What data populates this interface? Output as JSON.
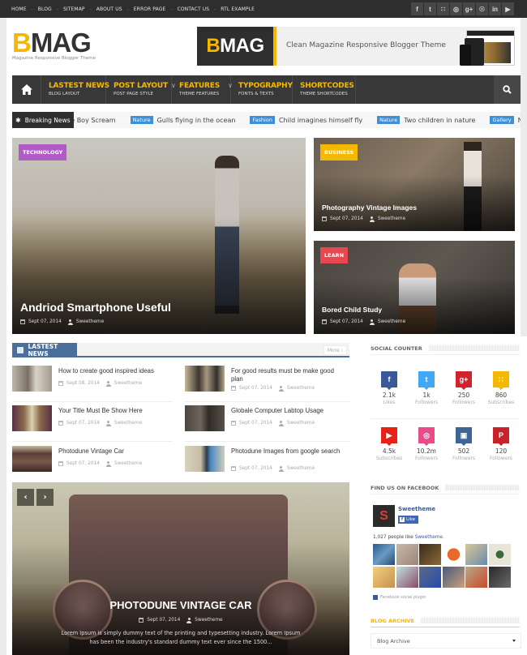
{
  "topbar": {
    "menu": [
      "HOME",
      "BLOG",
      "SITEMAP",
      "ABOUT US",
      "ERROR PAGE",
      "CONTACT US",
      "RTL EXAMPLE"
    ],
    "social": [
      {
        "icon": "facebook-icon",
        "glyph": "f"
      },
      {
        "icon": "twitter-icon",
        "glyph": "t"
      },
      {
        "icon": "rss-icon",
        "glyph": "∷"
      },
      {
        "icon": "dribbble-icon",
        "glyph": "◎"
      },
      {
        "icon": "google-plus-icon",
        "glyph": "g+"
      },
      {
        "icon": "pinterest-icon",
        "glyph": "☉"
      },
      {
        "icon": "linkedin-icon",
        "glyph": "in"
      },
      {
        "icon": "youtube-icon",
        "glyph": "▶"
      }
    ]
  },
  "header": {
    "logo_first": "B",
    "logo_rest": "MAG",
    "tagline": "Magazine Responsive Blogger Theme",
    "banner_logo_first": "B",
    "banner_logo_rest": "MAG",
    "banner_text": "Clean Magazine Responsive Blogger Theme"
  },
  "nav": {
    "items": [
      {
        "title": "LASTEST NEWS",
        "sub": "BLOG LAYOUT",
        "dropdown": ""
      },
      {
        "title": "POST LAYOUT",
        "sub": "POST PAGE STYLE",
        "dropdown": "∨"
      },
      {
        "title": "FEATURES",
        "sub": "THEME FEATURES",
        "dropdown": "∨"
      },
      {
        "title": "TYPOGRAPHY",
        "sub": "FONTS & TEXTS",
        "dropdown": ""
      },
      {
        "title": "SHORTCODES",
        "sub": "THEME SHORTCODES",
        "dropdown": ""
      }
    ]
  },
  "ticker": {
    "label": "Breaking News",
    "items": [
      {
        "badge": "",
        "text": "le Boy Scream"
      },
      {
        "badge": "Nature",
        "text": "Gulls flying in the ocean"
      },
      {
        "badge": "Fashion",
        "text": "Child imagines himself fly"
      },
      {
        "badge": "Nature",
        "text": "Two children in nature"
      },
      {
        "badge": "Gallery",
        "text": "Nice vie"
      }
    ]
  },
  "featured": [
    {
      "category": "TECHNOLOGY",
      "cat_color": "#b05cc4",
      "title": "Andriod Smartphone Useful",
      "date": "Sept 07, 2014",
      "author": "Sweetheme"
    },
    {
      "category": "BUSINESS",
      "cat_color": "#f5b800",
      "title": "Photography Vintage Images",
      "date": "Sept 07, 2014",
      "author": "Sweetheme"
    },
    {
      "category": "LEARN",
      "cat_color": "#e8474e",
      "title": "Bored Child Study",
      "date": "Sept 07, 2014",
      "author": "Sweetheme"
    }
  ],
  "latest": {
    "title": "LASTEST NEWS",
    "more": "More ›",
    "items": [
      {
        "title": "How to create good inspired ideas",
        "date": "Sept 08, 2014",
        "author": "Sweetheme"
      },
      {
        "title": "For good results must be make good plan",
        "date": "Sept 07, 2014",
        "author": "Sweetheme"
      },
      {
        "title": "Your Title Must Be Show Here",
        "date": "Sept 07, 2014",
        "author": "Sweetheme"
      },
      {
        "title": "Globale Computer Labtop Usage",
        "date": "Sept 07, 2014",
        "author": "Sweetheme"
      },
      {
        "title": "Photodune Vintage Car",
        "date": "Sept 07, 2014",
        "author": "Sweetheme"
      },
      {
        "title": "Photodune Images from google search",
        "date": "Sept 07, 2014",
        "author": "Sweetheme"
      }
    ]
  },
  "slider": {
    "prev": "‹",
    "next": "›",
    "title": "PHOTODUNE VINTAGE CAR",
    "date": "Sept 07, 2014",
    "author": "Sweetheme",
    "excerpt": "Lorem Ipsum is simply dummy text of the printing and typesetting industry. Lorem Ipsum has been the industry's standard dummy text ever since the 1500..."
  },
  "sidebar": {
    "social_title": "SOCIAL COUNTER",
    "social": [
      {
        "icon": "facebook-icon",
        "glyph": "f",
        "color": "#3b5998",
        "count": "2.1k",
        "label": "Likes"
      },
      {
        "icon": "twitter-icon",
        "glyph": "t",
        "color": "#3fa9f5",
        "count": "1k",
        "label": "Followers"
      },
      {
        "icon": "google-plus-icon",
        "glyph": "g+",
        "color": "#d0232d",
        "count": "250",
        "label": "Followers"
      },
      {
        "icon": "rss-icon",
        "glyph": "∷",
        "color": "#f5b800",
        "count": "860",
        "label": "Subscribes"
      },
      {
        "icon": "youtube-icon",
        "glyph": "▶",
        "color": "#e62117",
        "count": "4.5k",
        "label": "Subscribes"
      },
      {
        "icon": "dribbble-icon",
        "glyph": "◎",
        "color": "#ea4c89",
        "count": "10.2m",
        "label": "Followers"
      },
      {
        "icon": "instagram-icon",
        "glyph": "▣",
        "color": "#3f6596",
        "count": "502",
        "label": "Followers"
      },
      {
        "icon": "pinterest-icon",
        "glyph": "P",
        "color": "#c8232c",
        "count": "120",
        "label": "Followers"
      }
    ],
    "facebook_title": "FIND US ON FACEBOOK",
    "fb_name": "Sweetheme",
    "fb_avatar_letter": "S",
    "fb_like": "Like",
    "fb_people_prefix": "1,027 people like ",
    "fb_people_page": "Sweetheme.",
    "fb_plugin": "Facebook social plugin",
    "archive_title": "BLOG ARCHIVE",
    "archive_selected": "Blog Archive"
  }
}
